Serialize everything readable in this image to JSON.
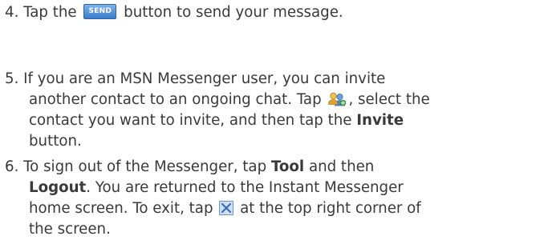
{
  "steps": [
    {
      "number": "4.",
      "text_before": "Tap the",
      "button_label": "SEND",
      "text_after": "button to send your message."
    },
    {
      "number": "5.",
      "line1": "If you are an MSN Messenger user, you can invite",
      "line2_before": "another contact to an ongoing chat. Tap",
      "line2_icon": "invite-contact-icon",
      "line2_after": ", select the",
      "line3_before": "contact you want to invite, and then tap the",
      "line3_bold": "Invite",
      "line4": "button."
    },
    {
      "number": "6.",
      "line1_before": "To sign out of the Messenger, tap",
      "line1_bold": "Tool",
      "line1_after": "and then",
      "line2_bold": "Logout",
      "line2_after": ". You are returned to the Instant Messenger",
      "line3_before": "home screen. To exit, tap",
      "line3_icon": "close-x-icon",
      "line3_after": "at the top right corner of",
      "line4": "the screen."
    }
  ],
  "colors": {
    "text": "#3a3a3a",
    "send_button": "#3b7cc9",
    "close_icon": "#3a6fb5"
  }
}
